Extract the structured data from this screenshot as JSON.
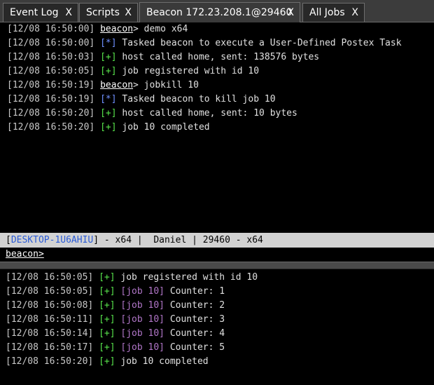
{
  "tabs": [
    {
      "label": "Event Log",
      "close": "X"
    },
    {
      "label": "Scripts",
      "close": "X"
    },
    {
      "label": "Beacon 172.23.208.1@29460",
      "close": "X"
    },
    {
      "label": "All Jobs",
      "close": "X"
    }
  ],
  "top_console": {
    "lines": [
      {
        "ts": "[12/08 16:50:00]",
        "prompt": "beacon",
        "gt": ">",
        "text": " demo x64"
      },
      {
        "ts": "[12/08 16:50:00]",
        "tag": "[*]",
        "text": " Tasked beacon to execute a User-Defined Postex Task"
      },
      {
        "ts": "[12/08 16:50:03]",
        "tag": "[+]",
        "text": " host called home, sent: 138576 bytes"
      },
      {
        "ts": "[12/08 16:50:05]",
        "tag": "[+]",
        "text": " job registered with id 10"
      },
      {
        "ts": "[12/08 16:50:19]",
        "prompt": "beacon",
        "gt": ">",
        "text": " jobkill 10"
      },
      {
        "ts": "[12/08 16:50:19]",
        "tag": "[*]",
        "text": " Tasked beacon to kill job 10"
      },
      {
        "ts": "[12/08 16:50:20]",
        "tag": "[+]",
        "text": " host called home, sent: 10 bytes"
      },
      {
        "ts": "[12/08 16:50:20]",
        "tag": "[+]",
        "text": " job 10 completed"
      }
    ]
  },
  "status": {
    "open_bracket": "[",
    "host": "DESKTOP-1U6AHIU",
    "rest": "] - x64 |  Daniel | 29460 - x64"
  },
  "input": {
    "prompt": "beacon",
    "gt": ">"
  },
  "bottom_console": {
    "lines": [
      {
        "ts": "[12/08 16:50:05]",
        "tag": "[+]",
        "job": "",
        "text": " job registered with id 10"
      },
      {
        "ts": "[12/08 16:50:05]",
        "tag": "[+]",
        "job": "[job 10]",
        "text": " Counter: 1"
      },
      {
        "ts": "[12/08 16:50:08]",
        "tag": "[+]",
        "job": "[job 10]",
        "text": " Counter: 2"
      },
      {
        "ts": "[12/08 16:50:11]",
        "tag": "[+]",
        "job": "[job 10]",
        "text": " Counter: 3"
      },
      {
        "ts": "[12/08 16:50:14]",
        "tag": "[+]",
        "job": "[job 10]",
        "text": " Counter: 4"
      },
      {
        "ts": "[12/08 16:50:17]",
        "tag": "[+]",
        "job": "[job 10]",
        "text": " Counter: 5"
      },
      {
        "ts": "[12/08 16:50:20]",
        "tag": "[+]",
        "job": "",
        "text": " job 10 completed"
      }
    ]
  },
  "colors": {
    "info_tag": "#6f90ff",
    "ok_tag": "#57e34b",
    "job_tag": "#b176c8",
    "status_host": "#2a5bd7"
  }
}
